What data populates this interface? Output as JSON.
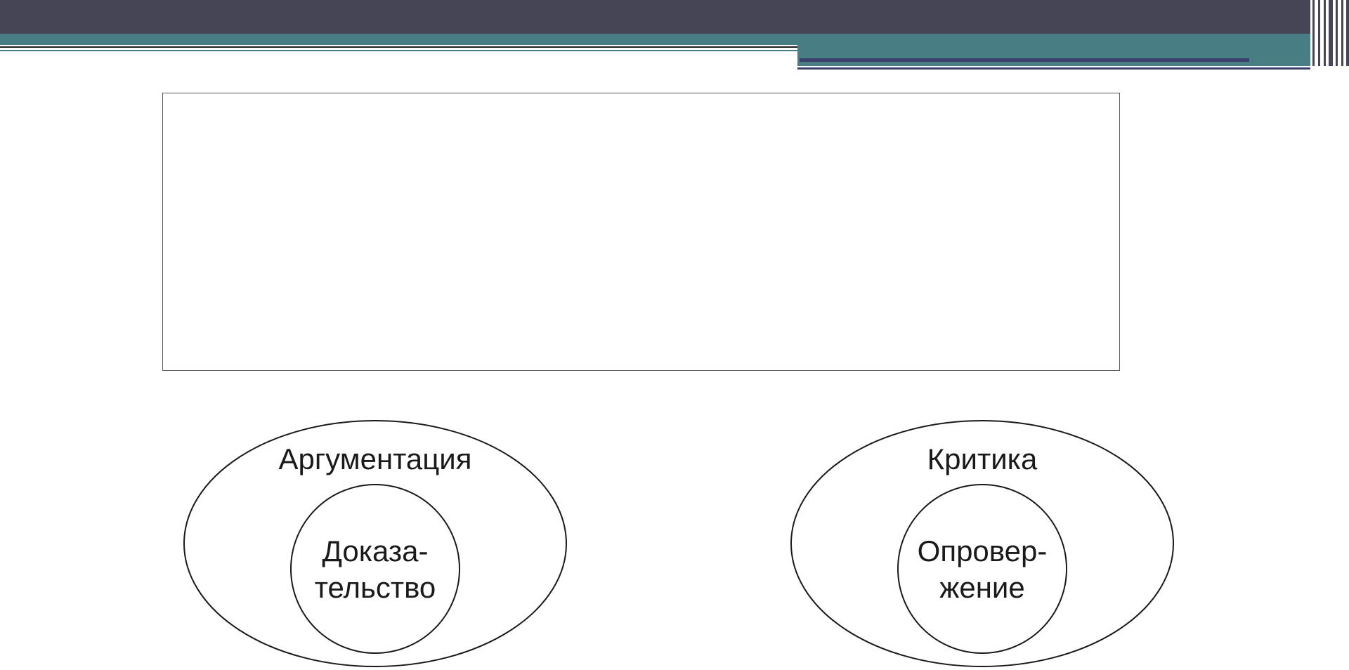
{
  "colors": {
    "header_dark": "#454556",
    "header_teal": "#487d84",
    "header_navy": "#3a3f6b",
    "line": "#1a1a1a"
  },
  "text_box": {
    "content": ""
  },
  "diagram": {
    "left": {
      "outer_label": "Аргументация",
      "inner_line1": "Доказа-",
      "inner_line2": "тельство"
    },
    "right": {
      "outer_label": "Критика",
      "inner_line1": "Опровер-",
      "inner_line2": "жение"
    }
  }
}
